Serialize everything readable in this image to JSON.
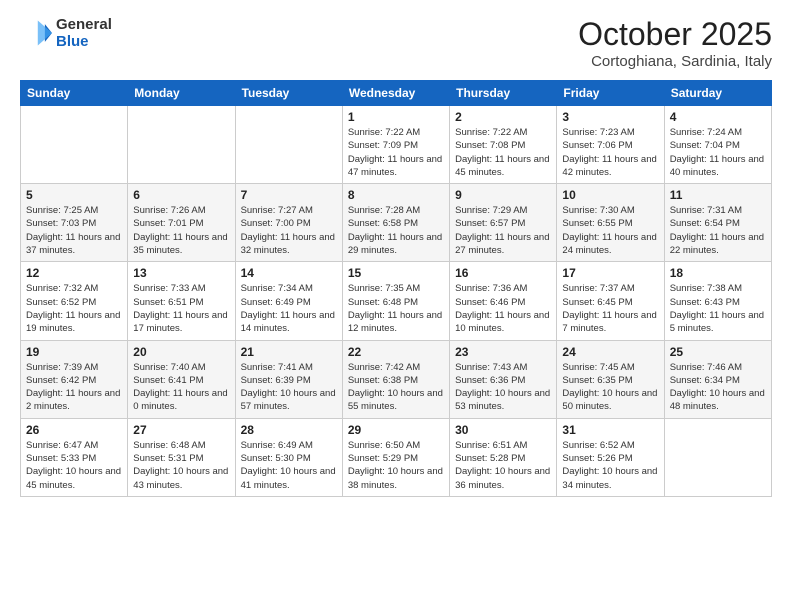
{
  "header": {
    "logo_general": "General",
    "logo_blue": "Blue",
    "month_title": "October 2025",
    "location": "Cortoghiana, Sardinia, Italy"
  },
  "days_of_week": [
    "Sunday",
    "Monday",
    "Tuesday",
    "Wednesday",
    "Thursday",
    "Friday",
    "Saturday"
  ],
  "weeks": [
    [
      {
        "num": "",
        "info": ""
      },
      {
        "num": "",
        "info": ""
      },
      {
        "num": "",
        "info": ""
      },
      {
        "num": "1",
        "info": "Sunrise: 7:22 AM\nSunset: 7:09 PM\nDaylight: 11 hours\nand 47 minutes."
      },
      {
        "num": "2",
        "info": "Sunrise: 7:22 AM\nSunset: 7:08 PM\nDaylight: 11 hours\nand 45 minutes."
      },
      {
        "num": "3",
        "info": "Sunrise: 7:23 AM\nSunset: 7:06 PM\nDaylight: 11 hours\nand 42 minutes."
      },
      {
        "num": "4",
        "info": "Sunrise: 7:24 AM\nSunset: 7:04 PM\nDaylight: 11 hours\nand 40 minutes."
      }
    ],
    [
      {
        "num": "5",
        "info": "Sunrise: 7:25 AM\nSunset: 7:03 PM\nDaylight: 11 hours\nand 37 minutes."
      },
      {
        "num": "6",
        "info": "Sunrise: 7:26 AM\nSunset: 7:01 PM\nDaylight: 11 hours\nand 35 minutes."
      },
      {
        "num": "7",
        "info": "Sunrise: 7:27 AM\nSunset: 7:00 PM\nDaylight: 11 hours\nand 32 minutes."
      },
      {
        "num": "8",
        "info": "Sunrise: 7:28 AM\nSunset: 6:58 PM\nDaylight: 11 hours\nand 29 minutes."
      },
      {
        "num": "9",
        "info": "Sunrise: 7:29 AM\nSunset: 6:57 PM\nDaylight: 11 hours\nand 27 minutes."
      },
      {
        "num": "10",
        "info": "Sunrise: 7:30 AM\nSunset: 6:55 PM\nDaylight: 11 hours\nand 24 minutes."
      },
      {
        "num": "11",
        "info": "Sunrise: 7:31 AM\nSunset: 6:54 PM\nDaylight: 11 hours\nand 22 minutes."
      }
    ],
    [
      {
        "num": "12",
        "info": "Sunrise: 7:32 AM\nSunset: 6:52 PM\nDaylight: 11 hours\nand 19 minutes."
      },
      {
        "num": "13",
        "info": "Sunrise: 7:33 AM\nSunset: 6:51 PM\nDaylight: 11 hours\nand 17 minutes."
      },
      {
        "num": "14",
        "info": "Sunrise: 7:34 AM\nSunset: 6:49 PM\nDaylight: 11 hours\nand 14 minutes."
      },
      {
        "num": "15",
        "info": "Sunrise: 7:35 AM\nSunset: 6:48 PM\nDaylight: 11 hours\nand 12 minutes."
      },
      {
        "num": "16",
        "info": "Sunrise: 7:36 AM\nSunset: 6:46 PM\nDaylight: 11 hours\nand 10 minutes."
      },
      {
        "num": "17",
        "info": "Sunrise: 7:37 AM\nSunset: 6:45 PM\nDaylight: 11 hours\nand 7 minutes."
      },
      {
        "num": "18",
        "info": "Sunrise: 7:38 AM\nSunset: 6:43 PM\nDaylight: 11 hours\nand 5 minutes."
      }
    ],
    [
      {
        "num": "19",
        "info": "Sunrise: 7:39 AM\nSunset: 6:42 PM\nDaylight: 11 hours\nand 2 minutes."
      },
      {
        "num": "20",
        "info": "Sunrise: 7:40 AM\nSunset: 6:41 PM\nDaylight: 11 hours\nand 0 minutes."
      },
      {
        "num": "21",
        "info": "Sunrise: 7:41 AM\nSunset: 6:39 PM\nDaylight: 10 hours\nand 57 minutes."
      },
      {
        "num": "22",
        "info": "Sunrise: 7:42 AM\nSunset: 6:38 PM\nDaylight: 10 hours\nand 55 minutes."
      },
      {
        "num": "23",
        "info": "Sunrise: 7:43 AM\nSunset: 6:36 PM\nDaylight: 10 hours\nand 53 minutes."
      },
      {
        "num": "24",
        "info": "Sunrise: 7:45 AM\nSunset: 6:35 PM\nDaylight: 10 hours\nand 50 minutes."
      },
      {
        "num": "25",
        "info": "Sunrise: 7:46 AM\nSunset: 6:34 PM\nDaylight: 10 hours\nand 48 minutes."
      }
    ],
    [
      {
        "num": "26",
        "info": "Sunrise: 6:47 AM\nSunset: 5:33 PM\nDaylight: 10 hours\nand 45 minutes."
      },
      {
        "num": "27",
        "info": "Sunrise: 6:48 AM\nSunset: 5:31 PM\nDaylight: 10 hours\nand 43 minutes."
      },
      {
        "num": "28",
        "info": "Sunrise: 6:49 AM\nSunset: 5:30 PM\nDaylight: 10 hours\nand 41 minutes."
      },
      {
        "num": "29",
        "info": "Sunrise: 6:50 AM\nSunset: 5:29 PM\nDaylight: 10 hours\nand 38 minutes."
      },
      {
        "num": "30",
        "info": "Sunrise: 6:51 AM\nSunset: 5:28 PM\nDaylight: 10 hours\nand 36 minutes."
      },
      {
        "num": "31",
        "info": "Sunrise: 6:52 AM\nSunset: 5:26 PM\nDaylight: 10 hours\nand 34 minutes."
      },
      {
        "num": "",
        "info": ""
      }
    ]
  ]
}
